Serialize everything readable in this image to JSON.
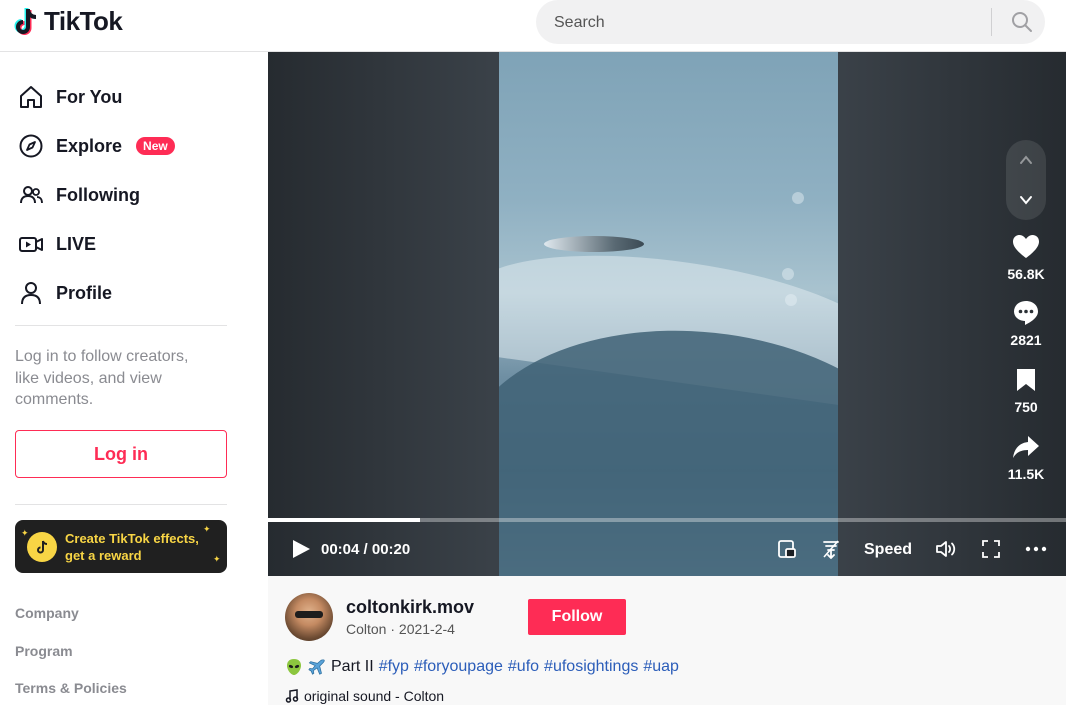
{
  "header": {
    "brand": "TikTok",
    "search_placeholder": "Search"
  },
  "sidebar": {
    "nav": [
      {
        "label": "For You",
        "icon": "home-icon"
      },
      {
        "label": "Explore",
        "icon": "compass-icon",
        "badge": "New"
      },
      {
        "label": "Following",
        "icon": "users-icon"
      },
      {
        "label": "LIVE",
        "icon": "live-camera-icon"
      },
      {
        "label": "Profile",
        "icon": "person-icon"
      }
    ],
    "login_prompt": "Log in to follow creators, like videos, and view comments.",
    "login_label": "Log in",
    "effects_banner": "Create TikTok effects, get a reward",
    "footer_links": [
      "Company",
      "Program",
      "Terms & Policies"
    ]
  },
  "player": {
    "time": "00:04 / 00:20",
    "progress": 0.19,
    "speed_label": "Speed",
    "actions": [
      {
        "icon": "heart-icon",
        "count": "56.8K"
      },
      {
        "icon": "comment-icon",
        "count": "2821"
      },
      {
        "icon": "bookmark-icon",
        "count": "750"
      },
      {
        "icon": "share-icon",
        "count": "11.5K"
      }
    ]
  },
  "post": {
    "username": "coltonkirk.mov",
    "subline": "Colton · 2021-2-4",
    "follow_label": "Follow",
    "caption_text": "Part II",
    "hashtags": [
      "#fyp",
      "#foryoupage",
      "#ufo",
      "#ufosightings",
      "#uap"
    ],
    "sound": "original sound - Colton"
  },
  "colors": {
    "brand_red": "#fe2c55",
    "hashtag_blue": "#2b5db9",
    "effects_yellow": "#f8d545"
  }
}
